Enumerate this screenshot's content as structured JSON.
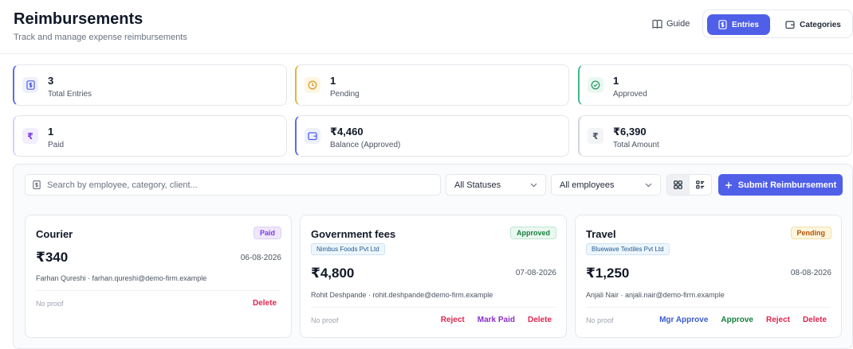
{
  "header": {
    "title": "Reimbursements",
    "subtitle": "Track and manage expense reimbursements",
    "guide_label": "Guide",
    "tabs": [
      {
        "label": "Entries",
        "active": true
      },
      {
        "label": "Categories",
        "active": false
      }
    ]
  },
  "stats": [
    {
      "value": "3",
      "label": "Total Entries",
      "icon": "receipt-icon"
    },
    {
      "value": "1",
      "label": "Pending",
      "icon": "clock-icon"
    },
    {
      "value": "1",
      "label": "Approved",
      "icon": "check-circle-icon"
    },
    {
      "value": "1",
      "label": "Paid",
      "icon": "rupee-icon",
      "icon_text": "₹"
    },
    {
      "value": "₹4,460",
      "label": "Balance (Approved)",
      "icon": "wallet-icon"
    },
    {
      "value": "₹6,390",
      "label": "Total Amount",
      "icon": "rupee-icon",
      "icon_text": "₹"
    }
  ],
  "toolbar": {
    "search_placeholder": "Search by employee, category, client...",
    "status_filter": "All Statuses",
    "employee_filter": "All employees",
    "submit_label": "Submit Reimbursement"
  },
  "entries": [
    {
      "title": "Courier",
      "status": "Paid",
      "client": "",
      "amount": "₹340",
      "date": "06-08-2026",
      "person": "Farhan Qureshi · farhan.qureshi@demo-firm.example",
      "proof": "No proof",
      "actions": [
        "Delete"
      ]
    },
    {
      "title": "Government fees",
      "status": "Approved",
      "client": "Nimbus Foods Pvt Ltd",
      "amount": "₹4,800",
      "date": "07-08-2026",
      "person": "Rohit Deshpande · rohit.deshpande@demo-firm.example",
      "proof": "No proof",
      "actions": [
        "Reject",
        "Mark Paid",
        "Delete"
      ]
    },
    {
      "title": "Travel",
      "status": "Pending",
      "client": "Bluewave Textiles Pvt Ltd",
      "amount": "₹1,250",
      "date": "08-08-2026",
      "person": "Anjali Nair · anjali.nair@demo-firm.example",
      "proof": "No proof",
      "actions": [
        "Mgr Approve",
        "Approve",
        "Reject",
        "Delete"
      ]
    }
  ],
  "colors": {
    "primary": "#4f5fe8",
    "pending": "#e3b341",
    "approved": "#3fb98a",
    "paid": "#7c3aed",
    "danger": "#dc2650"
  }
}
